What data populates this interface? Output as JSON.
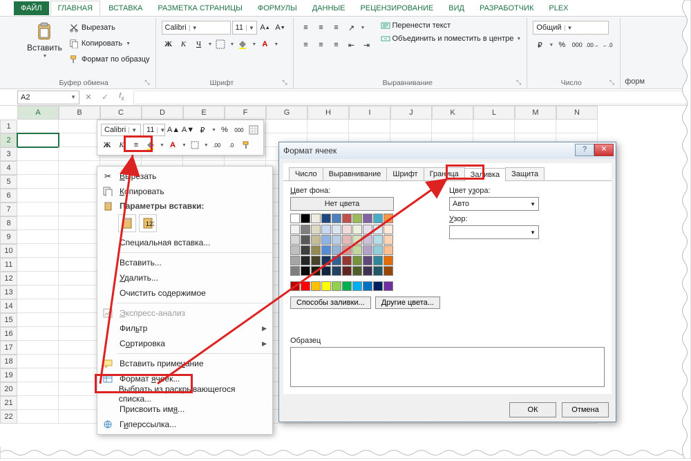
{
  "tabs": {
    "file": "ФАЙЛ",
    "home": "ГЛАВНАЯ",
    "insert": "ВСТАВКА",
    "pagelayout": "РАЗМЕТКА СТРАНИЦЫ",
    "formulas": "ФОРМУЛЫ",
    "data": "ДАННЫЕ",
    "review": "РЕЦЕНЗИРОВАНИЕ",
    "view": "ВИД",
    "developer": "РАЗРАБОТЧИК",
    "plex": "PLEX"
  },
  "ribbon": {
    "clipboard": {
      "title": "Буфер обмена",
      "paste": "Вставить",
      "cut": "Вырезать",
      "copy": "Копировать",
      "painter": "Формат по образцу"
    },
    "font": {
      "title": "Шрифт",
      "name": "Calibri",
      "size": "11",
      "bold": "Ж",
      "italic": "К",
      "underline": "Ч"
    },
    "align": {
      "title": "Выравнивание",
      "wrap": "Перенести текст",
      "merge": "Объединить и поместить в центре"
    },
    "number": {
      "title": "Число",
      "format": "Общий"
    },
    "extra": "форм"
  },
  "namebox": "A2",
  "cols": [
    "A",
    "B",
    "C",
    "D",
    "E",
    "F",
    "G",
    "H",
    "I",
    "J",
    "K",
    "L",
    "M",
    "N"
  ],
  "rows": [
    "1",
    "2",
    "3",
    "4",
    "5",
    "6",
    "7",
    "8",
    "9",
    "10",
    "11",
    "12",
    "13",
    "14",
    "15",
    "16",
    "17",
    "18",
    "19",
    "20",
    "21",
    "22"
  ],
  "minitb": {
    "font": "Calibri",
    "size": "11"
  },
  "ctx": {
    "cut": "Вырезать",
    "copy": "Копировать",
    "pastehdr": "Параметры вставки:",
    "pastespecial": "Специальная вставка...",
    "insert": "Вставить...",
    "delete": "Удалить...",
    "clear": "Очистить содержимое",
    "quick": "Экспресс-анализ",
    "filter": "Фильтр",
    "sort": "Сортировка",
    "comment": "Вставить примечание",
    "format": "Формат ячеек...",
    "dropdown": "Выбрать из раскрывающегося списка...",
    "name": "Присвоить имя...",
    "link": "Гиперссылка..."
  },
  "dlg": {
    "title": "Формат ячеек",
    "tabs": {
      "number": "Число",
      "align": "Выравнивание",
      "font": "Шрифт",
      "border": "Граница",
      "fill": "Заливка",
      "protect": "Защита"
    },
    "bgcolor": "Цвет фона:",
    "nocolor": "Нет цвета",
    "fillways": "Способы заливки...",
    "othercolors": "Другие цвета...",
    "patterncolor": "Цвет узора:",
    "auto": "Авто",
    "pattern": "Узор:",
    "sample": "Образец",
    "ok": "ОК",
    "cancel": "Отмена"
  },
  "palette_row1": [
    "#ffffff",
    "#000000",
    "#eeece1",
    "#1f497d",
    "#4f81bd",
    "#c0504d",
    "#9bbb59",
    "#8064a2",
    "#4bacc6",
    "#f79646"
  ],
  "palette_tints": [
    [
      "#f2f2f2",
      "#7f7f7f",
      "#ddd9c3",
      "#c6d9f0",
      "#dbe5f1",
      "#f2dcdb",
      "#ebf1dd",
      "#e5e0ec",
      "#dbeef3",
      "#fdeada"
    ],
    [
      "#d8d8d8",
      "#595959",
      "#c4bd97",
      "#8db3e2",
      "#b8cce4",
      "#e5b9b7",
      "#d7e3bc",
      "#ccc1d9",
      "#b7dde8",
      "#fbd5b5"
    ],
    [
      "#bfbfbf",
      "#3f3f3f",
      "#938953",
      "#548dd4",
      "#95b3d7",
      "#d99694",
      "#c3d69b",
      "#b2a2c7",
      "#92cddc",
      "#fac08f"
    ],
    [
      "#a5a5a5",
      "#262626",
      "#494429",
      "#17365d",
      "#366092",
      "#953734",
      "#76923c",
      "#5f497a",
      "#31859b",
      "#e36c09"
    ],
    [
      "#7f7f7f",
      "#0c0c0c",
      "#1d1b10",
      "#0f243e",
      "#244061",
      "#632423",
      "#4f6128",
      "#3f3151",
      "#205867",
      "#974806"
    ]
  ],
  "palette_std": [
    "#c00000",
    "#ff0000",
    "#ffc000",
    "#ffff00",
    "#92d050",
    "#00b050",
    "#00b0f0",
    "#0070c0",
    "#002060",
    "#7030a0"
  ]
}
